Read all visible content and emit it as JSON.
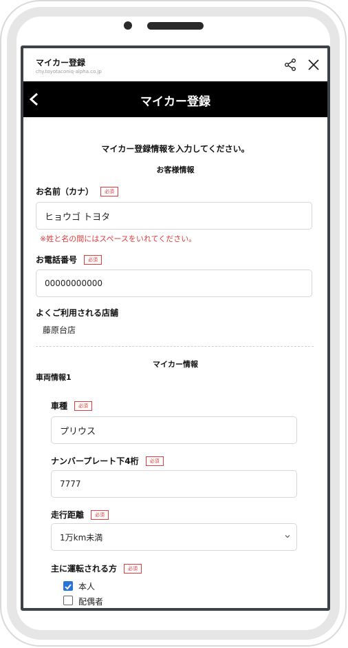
{
  "browser": {
    "title": "マイカー登録",
    "url": "chy.toyotaconiq-alpha.co.jp"
  },
  "appbar": {
    "title": "マイカー登録"
  },
  "form": {
    "instruction": "マイカー登録情報を入力してください。",
    "customer_section": "お客様情報",
    "required_tag": "必須",
    "name_kana": {
      "label": "お名前（カナ）",
      "value": "ヒョウゴ トヨタ",
      "note": "※姓と名の間にはスペースをいれてください。"
    },
    "phone": {
      "label": "お電話番号",
      "value": "00000000000"
    },
    "store": {
      "label": "よくご利用される店舗",
      "value": "藤原台店"
    },
    "mycar_section": "マイカー情報",
    "vehicle_heading": "車両情報1",
    "model": {
      "label": "車種",
      "value": "プリウス"
    },
    "plate": {
      "label": "ナンバープレート下4桁",
      "value": "7777"
    },
    "mileage": {
      "label": "走行距離",
      "value": "1万km未満"
    },
    "driver": {
      "label": "主に運転される方",
      "options": [
        {
          "label": "本人",
          "checked": true
        },
        {
          "label": "配偶者",
          "checked": false
        }
      ]
    }
  }
}
